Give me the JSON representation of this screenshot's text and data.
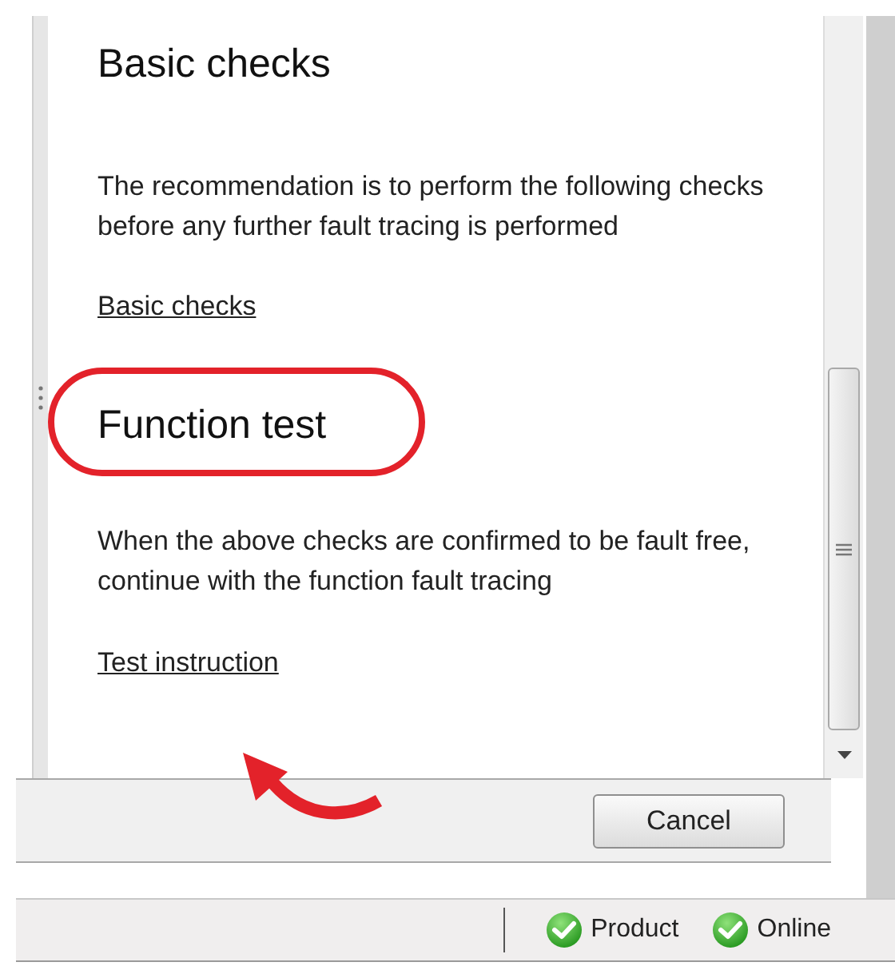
{
  "sections": [
    {
      "heading": "Basic checks",
      "text": "The recommendation is to perform the following checks before any further fault tracing is performed",
      "link": "Basic checks",
      "highlighted": false,
      "arrow": false
    },
    {
      "heading": "Function test",
      "text": "When the above checks are confirmed to be fault free, continue with the function fault tracing",
      "link": "Test instruction",
      "highlighted": true,
      "arrow": true
    }
  ],
  "dialog": {
    "buttons": [
      "Cancel"
    ]
  },
  "status_bar": {
    "items": [
      {
        "label": "Product",
        "ok": true
      },
      {
        "label": "Online",
        "ok": true
      }
    ]
  }
}
